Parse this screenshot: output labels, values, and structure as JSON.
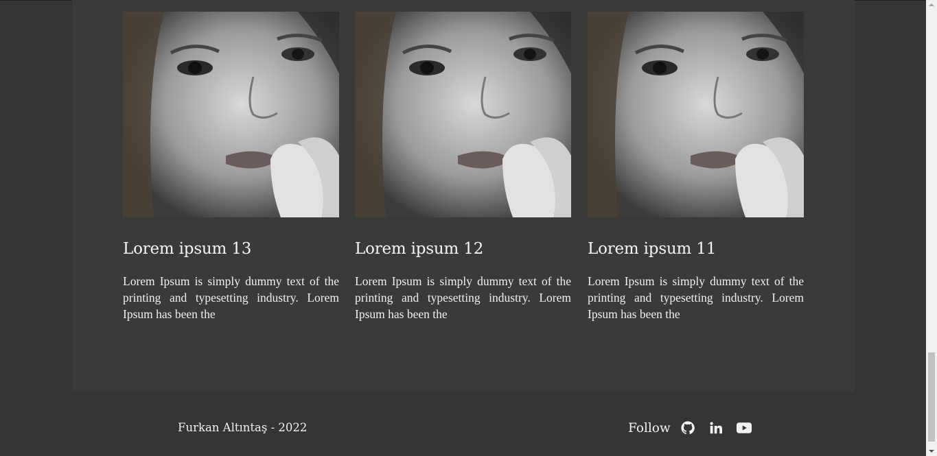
{
  "cards": [
    {
      "title": "Lorem ipsum 13",
      "text": "Lorem Ipsum is simply dummy text of the printing and typesetting industry. Lorem Ipsum has been the"
    },
    {
      "title": "Lorem ipsum 12",
      "text": "Lorem Ipsum is simply dummy text of the printing and typesetting industry. Lorem Ipsum has been the"
    },
    {
      "title": "Lorem ipsum 11",
      "text": "Lorem Ipsum is simply dummy text of the printing and typesetting industry. Lorem Ipsum has been the"
    }
  ],
  "footer": {
    "copyright": "Furkan Altıntaş - 2022",
    "follow_label": "Follow",
    "social_icons": [
      "github-icon",
      "linkedin-icon",
      "youtube-icon"
    ]
  },
  "colors": {
    "page_bg": "#353535",
    "container_bg": "#3a3a3a",
    "text": "#f2f2f2"
  }
}
